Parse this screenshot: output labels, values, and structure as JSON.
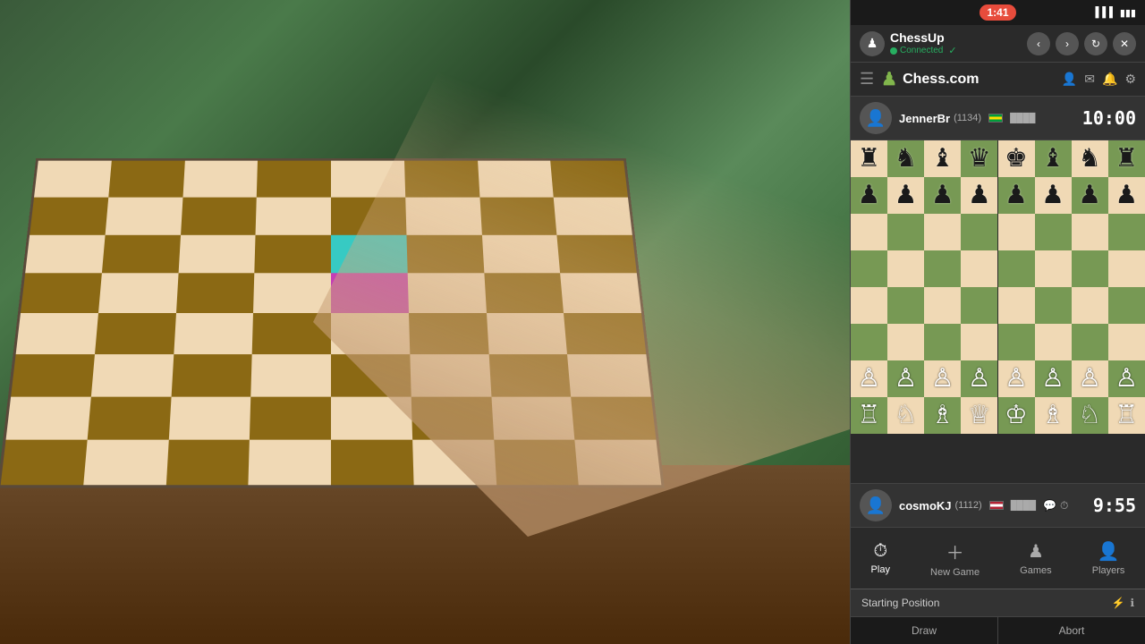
{
  "status_bar": {
    "time": "1:41",
    "signal_icon": "▌▌▌",
    "battery_icon": "▮▮▮"
  },
  "chessup": {
    "name": "ChessUp",
    "status": "Connected",
    "check_icon": "✓"
  },
  "header_buttons": {
    "prev": "‹",
    "next": "›",
    "refresh": "↻",
    "close": "✕"
  },
  "chess_logo": {
    "icon": "♟",
    "name": "Chess.com"
  },
  "nav_icons": {
    "person": "👤",
    "mail": "✉",
    "bell": "🔔",
    "gear": "⚙"
  },
  "players": {
    "top": {
      "name": "JennerBr",
      "rating": "(1134)",
      "flag_label": "BR",
      "signal": "████",
      "timer": "10:00",
      "pieces_row1": [
        "♜",
        "♞",
        "♝",
        "♛",
        "♚",
        "♝",
        "♞",
        "♜"
      ],
      "pieces_row2": [
        "♟",
        "♟",
        "♟",
        "♟",
        "♟",
        "♟",
        "♟",
        "♟"
      ]
    },
    "bottom": {
      "name": "cosmoKJ",
      "rating": "(1112)",
      "flag_label": "US",
      "signal": "████",
      "timer": "9:55",
      "pieces_row7": [
        "♙",
        "♙",
        "♙",
        "♙",
        "♙",
        "♙",
        "♙",
        "♙"
      ],
      "pieces_row8": [
        "♖",
        "♘",
        "♗",
        "♕",
        "♔",
        "♗",
        "♘",
        "♖"
      ]
    }
  },
  "board": {
    "rows": [
      [
        "♜",
        "♞",
        "♝",
        "♛",
        "♚",
        "♝",
        "♞",
        "♜"
      ],
      [
        "♟",
        "♟",
        "♟",
        "♟",
        "♟",
        "♟",
        "♟",
        "♟"
      ],
      [
        "",
        "",
        "",
        "",
        "",
        "",
        "",
        ""
      ],
      [
        "",
        "",
        "",
        "",
        "",
        "",
        "",
        ""
      ],
      [
        "",
        "",
        "",
        "",
        "",
        "",
        "",
        ""
      ],
      [
        "",
        "",
        "",
        "",
        "",
        "",
        "",
        ""
      ],
      [
        "♙",
        "♙",
        "♙",
        "♙",
        "♙",
        "♙",
        "♙",
        "♙"
      ],
      [
        "♖",
        "♘",
        "♗",
        "♕",
        "♔",
        "♗",
        "♘",
        "♖"
      ]
    ]
  },
  "bottom_nav": {
    "items": [
      {
        "key": "play",
        "icon": "⏱",
        "label": "Play"
      },
      {
        "key": "new_game",
        "icon": "＋",
        "label": "New Game"
      },
      {
        "key": "games",
        "icon": "♟",
        "label": "Games"
      },
      {
        "key": "players",
        "icon": "👤",
        "label": "Players"
      }
    ],
    "active": "play"
  },
  "starting_position": {
    "label": "Starting Position",
    "icon1": "⚡",
    "icon2": "ℹ"
  },
  "bottom_tabs": [
    {
      "key": "draw",
      "label": "Draw"
    },
    {
      "key": "abort",
      "label": "Abort"
    }
  ]
}
